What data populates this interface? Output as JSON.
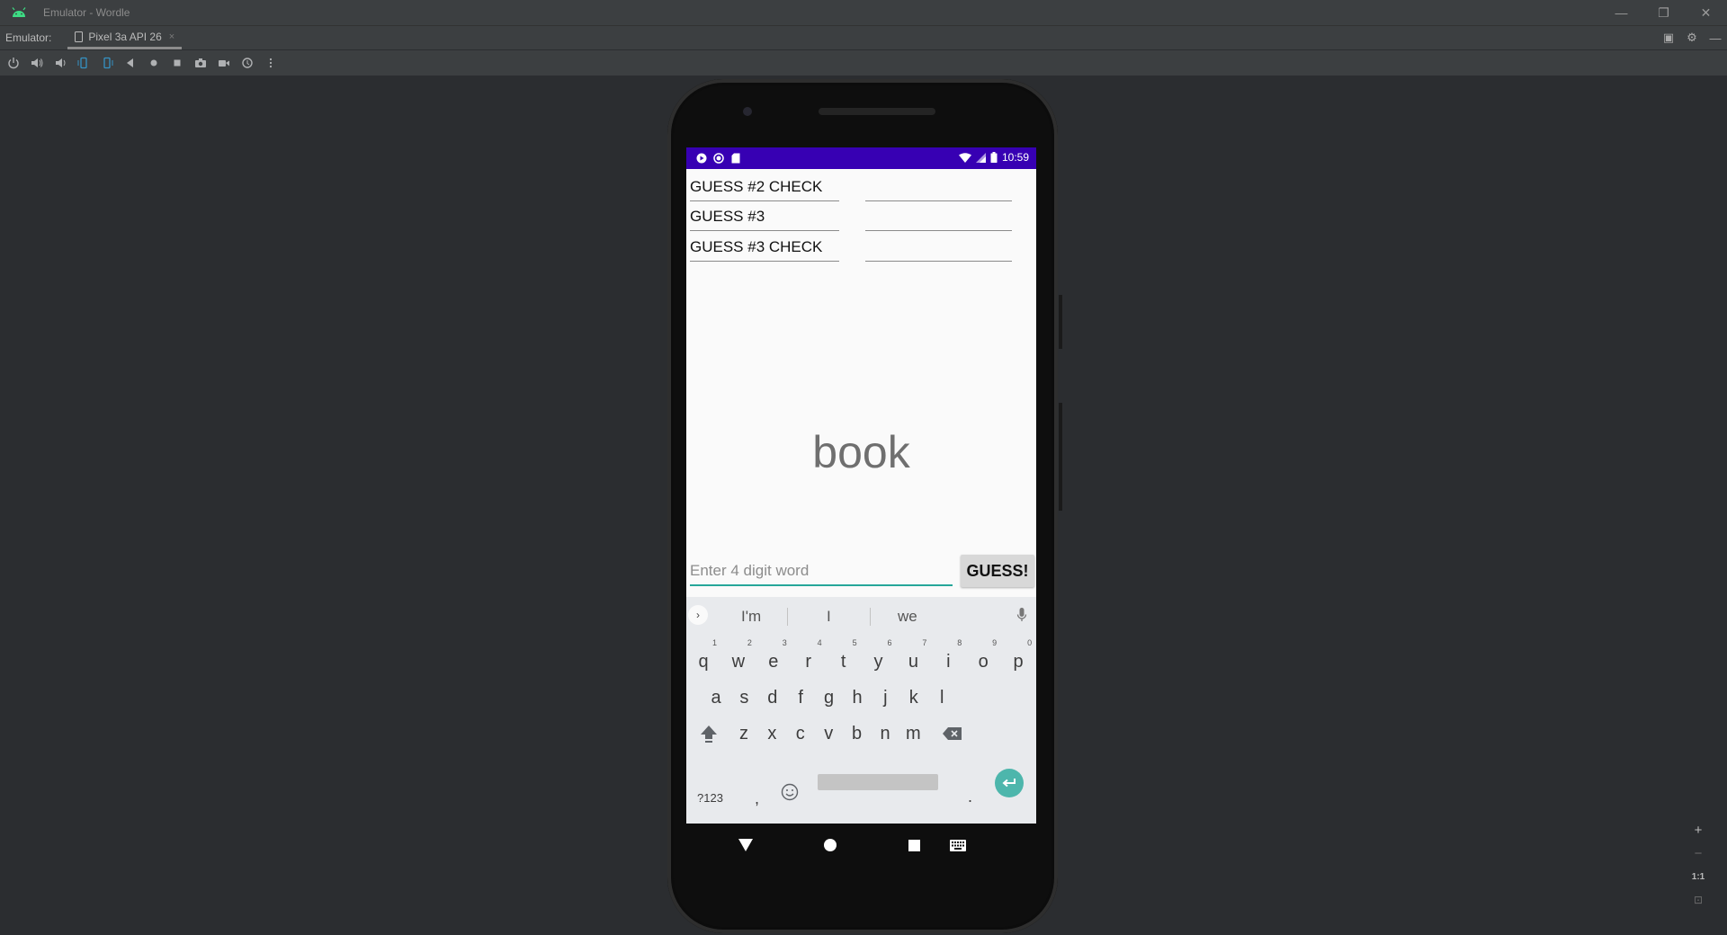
{
  "window": {
    "title": "Emulator - Wordle",
    "controls": [
      "minimize-icon",
      "restore-icon",
      "close-icon"
    ]
  },
  "tabbar": {
    "label": "Emulator:",
    "tab_label": "Pixel 3a API 26",
    "tab_close": "×"
  },
  "toolbar": {
    "icons": [
      "power-icon",
      "volume-up-icon",
      "volume-down-icon",
      "rotate-left-icon",
      "rotate-right-icon",
      "back-icon",
      "home-icon",
      "overview-icon",
      "screenshot-icon",
      "record-icon",
      "snapshot-icon",
      "more-icon"
    ]
  },
  "zoom": {
    "zoom_in": "+",
    "zoom_out": "−",
    "actual_size": "1:1",
    "fit_icon": "fit-screen-icon"
  },
  "device": {
    "status_bar": {
      "time": "10:59",
      "color": "#3700b3"
    },
    "app": {
      "rows": [
        {
          "label": "GUESS #2 CHECK",
          "value": ""
        },
        {
          "label": "GUESS #3",
          "value": ""
        },
        {
          "label": "GUESS #3 CHECK",
          "value": ""
        }
      ],
      "word": "book",
      "input_placeholder": "Enter 4 digit word",
      "input_value": "",
      "guess_button": "GUESS!",
      "accent": "#26a69a"
    },
    "keyboard": {
      "suggestions": [
        "I'm",
        "I",
        "we"
      ],
      "row1": [
        {
          "k": "q",
          "h": "1"
        },
        {
          "k": "w",
          "h": "2"
        },
        {
          "k": "e",
          "h": "3"
        },
        {
          "k": "r",
          "h": "4"
        },
        {
          "k": "t",
          "h": "5"
        },
        {
          "k": "y",
          "h": "6"
        },
        {
          "k": "u",
          "h": "7"
        },
        {
          "k": "i",
          "h": "8"
        },
        {
          "k": "o",
          "h": "9"
        },
        {
          "k": "p",
          "h": "0"
        }
      ],
      "row2": [
        "a",
        "s",
        "d",
        "f",
        "g",
        "h",
        "j",
        "k",
        "l"
      ],
      "row3": [
        "z",
        "x",
        "c",
        "v",
        "b",
        "n",
        "m"
      ],
      "symbols_key": "?123",
      "comma_key": ",",
      "period_key": ".",
      "enter_color": "#4db6ac"
    }
  }
}
